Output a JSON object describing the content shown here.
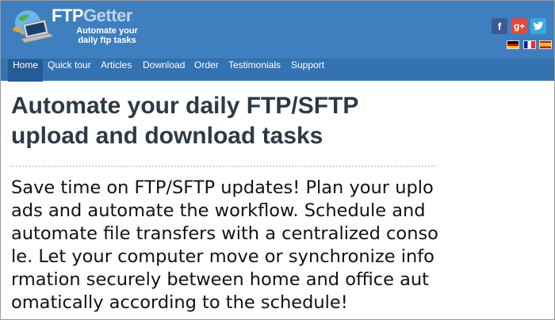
{
  "header": {
    "brand_prefix": "FTP",
    "brand_suffix": "Getter",
    "tagline_line1": "Automate your",
    "tagline_line2": "daily ftp tasks",
    "logo_icon": "laptop-globe-icon",
    "social": [
      {
        "name": "facebook-icon",
        "glyph": "f",
        "color": "#3b5998"
      },
      {
        "name": "google-plus-icon",
        "glyph": "g+",
        "color": "#dd4b39"
      },
      {
        "name": "twitter-icon",
        "glyph": "🐦",
        "color": "#37a9e1"
      }
    ],
    "flags": [
      "german-flag-icon",
      "french-flag-icon",
      "spanish-flag-icon"
    ]
  },
  "nav": {
    "items": [
      {
        "label": "Home",
        "active": true
      },
      {
        "label": "Quick tour"
      },
      {
        "label": "Articles"
      },
      {
        "label": "Download"
      },
      {
        "label": "Order"
      },
      {
        "label": "Testimonials"
      },
      {
        "label": "Support"
      }
    ]
  },
  "main": {
    "heading_line1": "Automate your daily FTP/SFTP",
    "heading_line2": "upload and download tasks",
    "lead": "Save time on FTP/SFTP updates! Plan your uploads and automate the workflow. Schedule and automate file transfers with a centralized console. Let your computer move or synchronize information securely between home and office automatically according to the schedule!"
  },
  "colors": {
    "header_bg": "#3f7fbf",
    "nav_bg": "#3472b1",
    "nav_active_bg": "#235c97",
    "heading": "#2d3a45"
  }
}
